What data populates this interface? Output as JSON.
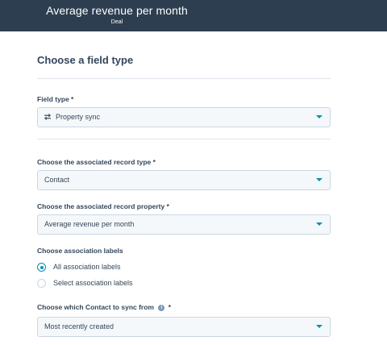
{
  "header": {
    "title": "Average revenue per month",
    "subtitle": "Deal"
  },
  "section_title": "Choose a field type",
  "field_type": {
    "label": "Field type *",
    "value": "Property sync",
    "icon": "sync-arrows-icon"
  },
  "record_type": {
    "label": "Choose the associated record type *",
    "value": "Contact"
  },
  "record_property": {
    "label": "Choose the associated record property *",
    "value": "Average revenue per month"
  },
  "association_labels": {
    "label": "Choose association labels",
    "options": [
      {
        "label": "All association labels",
        "selected": true
      },
      {
        "label": "Select association labels",
        "selected": false
      }
    ]
  },
  "sync_from": {
    "label_text": "Choose which Contact to sync from",
    "required_mark": "*",
    "info_icon": "info-icon",
    "value": "Most recently created"
  },
  "colors": {
    "header_bg": "#2d3e50",
    "accent": "#0091ae",
    "text": "#33475b",
    "field_bg": "#f5f8fa",
    "border": "#cbd6e2"
  }
}
